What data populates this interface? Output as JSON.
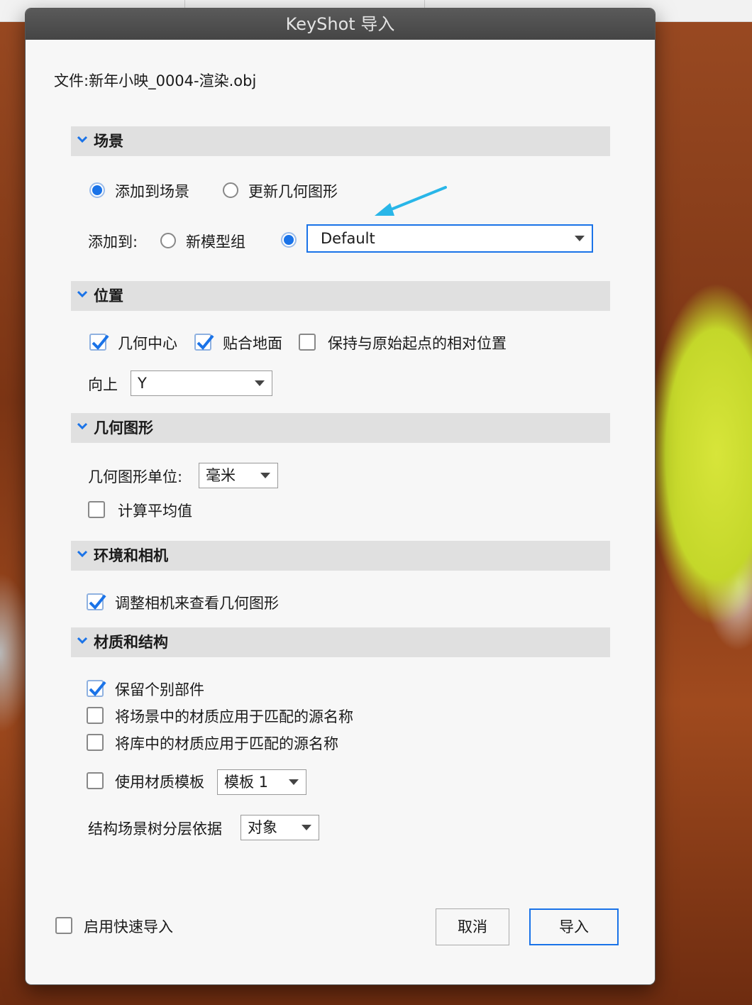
{
  "dialog": {
    "title": "KeyShot 导入",
    "file_label": "文件:",
    "file_name": "新年小映_0004-渲染.obj"
  },
  "scene": {
    "title": "场景",
    "option_add": "添加到场景",
    "option_update": "更新几何图形",
    "add_to_label": "添加到:",
    "new_model_group": "新模型组",
    "target_value": "Default",
    "selected_option": "添加到场景"
  },
  "position": {
    "title": "位置",
    "geometry_center": "几何中心",
    "snap_to_ground": "贴合地面",
    "keep_relative": "保持与原始起点的相对位置",
    "up_label": "向上",
    "up_value": "Y",
    "geometry_center_checked": true,
    "snap_to_ground_checked": true,
    "keep_relative_checked": false
  },
  "geometry": {
    "title": "几何图形",
    "unit_label": "几何图形单位:",
    "unit_value": "毫米",
    "compute_average": "计算平均值",
    "compute_average_checked": false
  },
  "environment": {
    "title": "环境和相机",
    "adjust_camera": "调整相机来查看几何图形",
    "adjust_camera_checked": true
  },
  "materials": {
    "title": "材质和结构",
    "keep_parts": "保留个别部件",
    "apply_scene_materials": "将场景中的材质应用于匹配的源名称",
    "apply_library_materials": "将库中的材质应用于匹配的源名称",
    "use_template": "使用材质模板",
    "template_value": "模板 1",
    "hierarchy_label": "结构场景树分层依据",
    "hierarchy_value": "对象",
    "keep_parts_checked": true,
    "apply_scene_materials_checked": false,
    "apply_library_materials_checked": false,
    "use_template_checked": false
  },
  "footer": {
    "fast_import": "启用快速导入",
    "fast_import_checked": false,
    "cancel": "取消",
    "import": "导入"
  },
  "annotation": {
    "arrow_color": "#29b6e8"
  },
  "colors": {
    "accent": "#1a73e8",
    "section_bg": "#e0e0e0"
  }
}
